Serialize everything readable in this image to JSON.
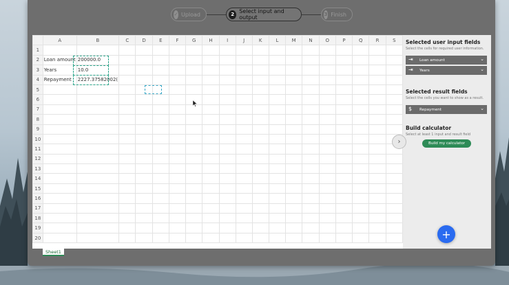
{
  "stepper": {
    "steps": [
      {
        "num": "✓",
        "label": "Upload"
      },
      {
        "num": "2",
        "label": "Select input and output"
      },
      {
        "num": "3",
        "label": "Finish"
      }
    ]
  },
  "sheet": {
    "columns": [
      "",
      "A",
      "B",
      "C",
      "D",
      "E",
      "F",
      "G",
      "H",
      "I",
      "J",
      "K",
      "L",
      "M",
      "N",
      "O",
      "P",
      "Q",
      "R",
      "S"
    ],
    "rows": [
      {
        "num": "1",
        "a": "",
        "b": ""
      },
      {
        "num": "2",
        "a": "Loan amount",
        "b": "200000.0"
      },
      {
        "num": "3",
        "a": "Years",
        "b": "10.0"
      },
      {
        "num": "4",
        "a": "Repayment",
        "b": "2227.37582002("
      },
      {
        "num": "5",
        "a": "",
        "b": ""
      },
      {
        "num": "6",
        "a": "",
        "b": ""
      },
      {
        "num": "7",
        "a": "",
        "b": ""
      },
      {
        "num": "8",
        "a": "",
        "b": ""
      },
      {
        "num": "9",
        "a": "",
        "b": ""
      },
      {
        "num": "10",
        "a": "",
        "b": ""
      },
      {
        "num": "11",
        "a": "",
        "b": ""
      },
      {
        "num": "12",
        "a": "",
        "b": ""
      },
      {
        "num": "13",
        "a": "",
        "b": ""
      },
      {
        "num": "14",
        "a": "",
        "b": ""
      },
      {
        "num": "15",
        "a": "",
        "b": ""
      },
      {
        "num": "16",
        "a": "",
        "b": ""
      },
      {
        "num": "17",
        "a": "",
        "b": ""
      },
      {
        "num": "18",
        "a": "",
        "b": ""
      },
      {
        "num": "19",
        "a": "",
        "b": ""
      },
      {
        "num": "20",
        "a": "",
        "b": ""
      }
    ],
    "tab_label": "Sheet1"
  },
  "sidebar": {
    "inputs_title": "Selected user input fields",
    "inputs_sub": "Select the cells for required user information.",
    "input_fields": [
      "Loan amount",
      "Years"
    ],
    "results_title": "Selected result fields",
    "results_sub": "Select the cells you want to show as a result.",
    "result_fields": [
      "Repayment"
    ],
    "build_title": "Build calculator",
    "build_sub": "Select at least 1 input and result field",
    "build_button": "Build my calculator"
  },
  "colors": {
    "accent_green": "#2e8b57",
    "fab_blue": "#2a6bf0"
  }
}
